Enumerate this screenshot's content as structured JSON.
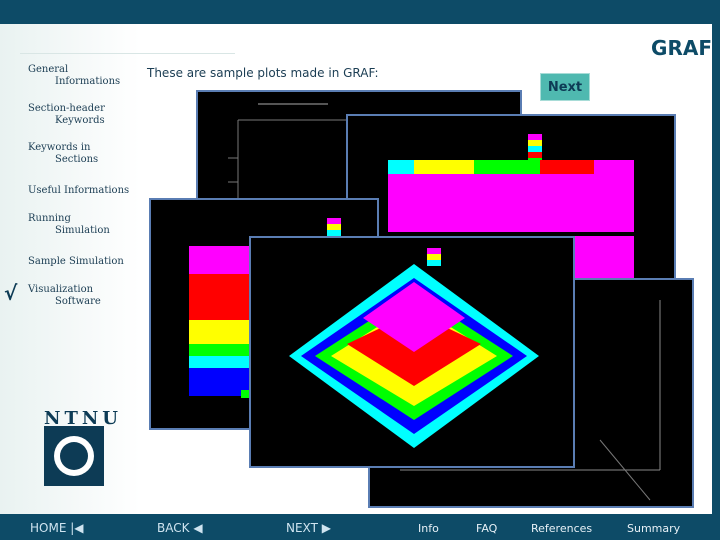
{
  "header": {
    "title": "GRAF"
  },
  "main": {
    "subtitle": "These are sample plots made in GRAF:",
    "next_label": "Next"
  },
  "sidebar": {
    "items": [
      {
        "line1": "General",
        "line2": "Informations"
      },
      {
        "line1": "Section-header",
        "line2": "Keywords"
      },
      {
        "line1": "Keywords in",
        "line2": "Sections"
      },
      {
        "line1": "Useful Informations",
        "line2": ""
      },
      {
        "line1": "Running",
        "line2": "Simulation"
      },
      {
        "line1": "Sample Simulation",
        "line2": ""
      },
      {
        "line1": "Visualization",
        "line2": "Software"
      }
    ],
    "checkmark": "√"
  },
  "logo": {
    "text": "NTNU"
  },
  "bottom_nav": {
    "home": "HOME",
    "back": "BACK",
    "next": "NEXT",
    "info": "Info",
    "faq": "FAQ",
    "references": "References",
    "summary": "Summary"
  },
  "icons": {
    "home": "home-icon",
    "back": "back-arrow-icon",
    "next": "next-arrow-icon",
    "logo": "ntnu-logo-icon"
  },
  "colors": {
    "brand": "#0d4b67",
    "next_button": "#4fb9b0",
    "plot_magenta": "#ff00ff",
    "plot_red": "#ff0000",
    "plot_yellow": "#ffff00",
    "plot_green": "#00ff00",
    "plot_cyan": "#00ffff",
    "plot_blue": "#0000ff"
  }
}
